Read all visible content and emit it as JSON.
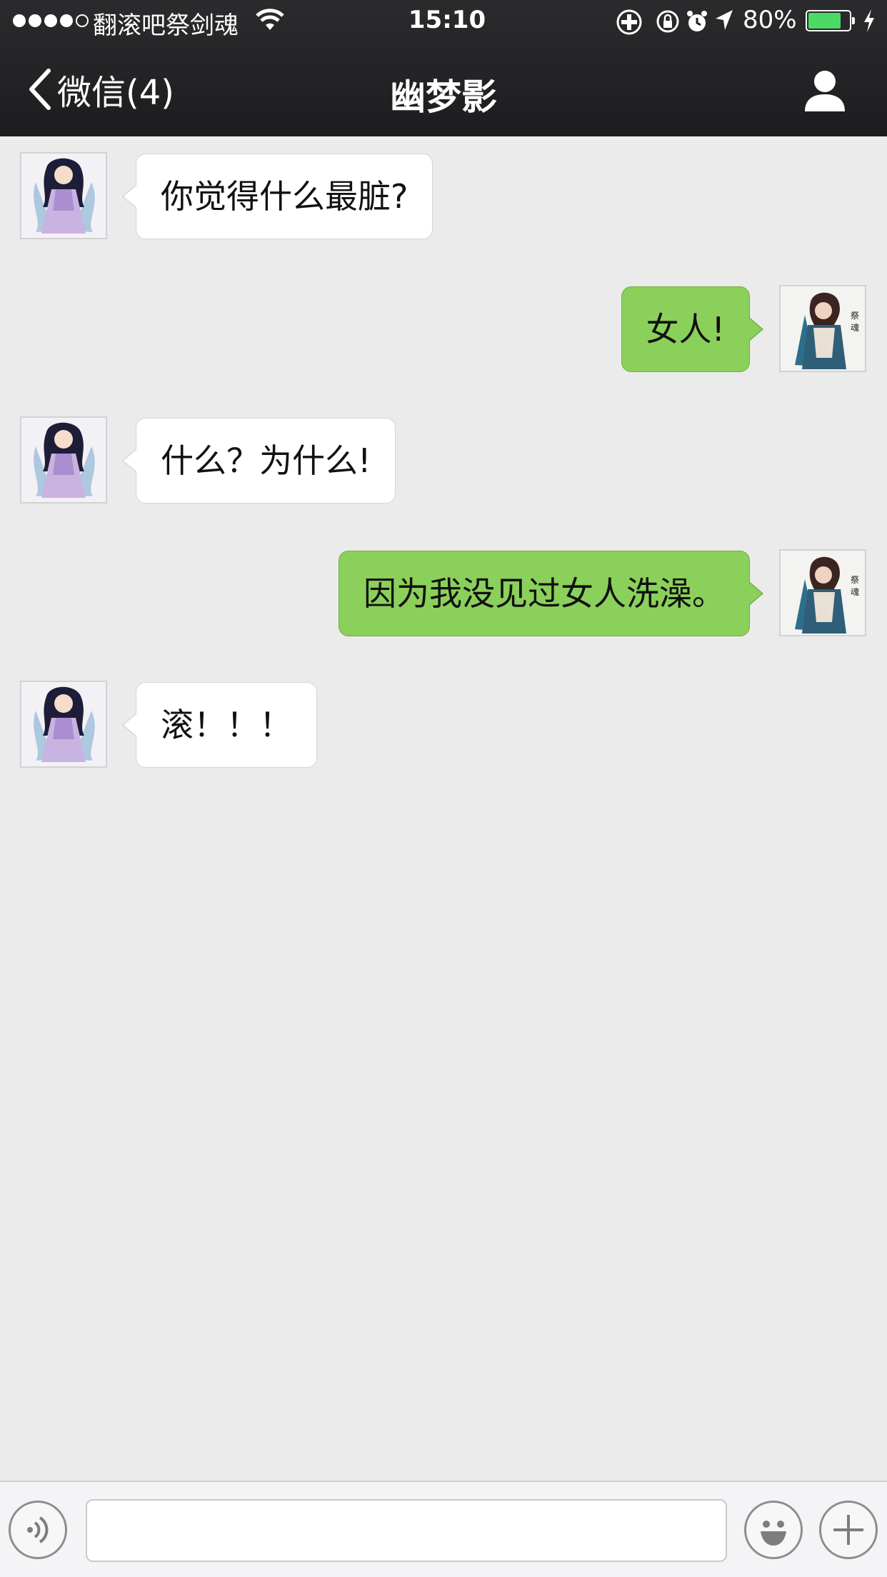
{
  "status_bar": {
    "carrier": "翻滚吧祭剑魂",
    "time": "15:10",
    "battery_percent": "80%",
    "battery_level": 0.8,
    "signal_bars": 4,
    "icons": [
      "wifi-icon",
      "sync-icon",
      "orientation-lock-icon",
      "alarm-icon",
      "location-icon",
      "charging-icon"
    ]
  },
  "nav": {
    "back_label": "微信(4)",
    "title": "幽梦影",
    "right_icon": "person-icon"
  },
  "messages": [
    {
      "side": "in",
      "text": "你觉得什么最脏?"
    },
    {
      "side": "out",
      "text": "女人!"
    },
    {
      "side": "in",
      "text": "什么？为什么!"
    },
    {
      "side": "out",
      "text": "因为我没见过女人洗澡。"
    },
    {
      "side": "in",
      "text": "滚！！！"
    }
  ],
  "input_bar": {
    "left_icon": "voice-icon",
    "emoji_icon": "emoji-icon",
    "plus_icon": "plus-icon",
    "text_value": ""
  },
  "colors": {
    "nav_bg": "#232325",
    "chat_bg": "#ebebeb",
    "incoming_bubble": "#ffffff",
    "outgoing_bubble": "#8bd05a",
    "battery_fill": "#4cd964"
  }
}
